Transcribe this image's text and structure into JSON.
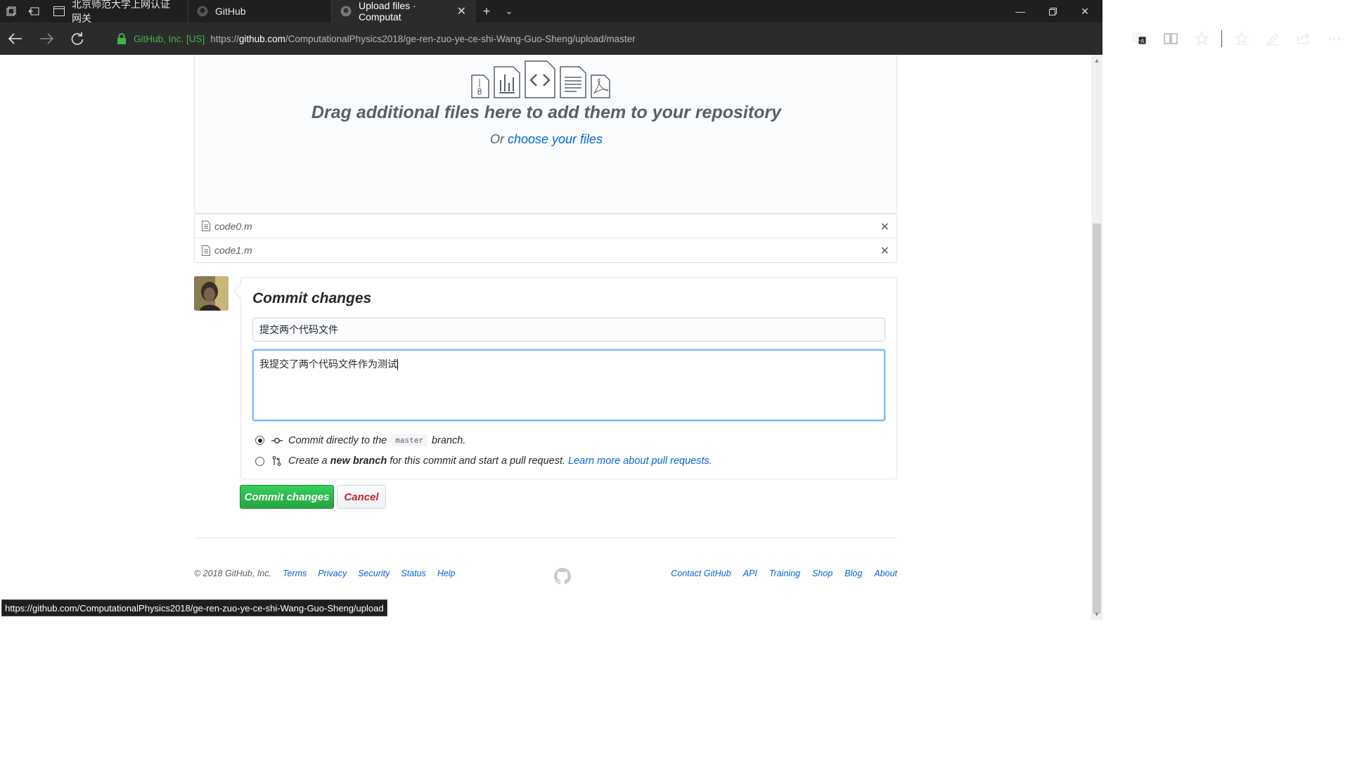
{
  "browser": {
    "tabs": [
      {
        "title": "北京师范大学上网认证网关",
        "active": false
      },
      {
        "title": "GitHub",
        "active": false
      },
      {
        "title": "Upload files · Computat",
        "active": true
      }
    ],
    "identity": "GitHub, Inc. [US]",
    "url_prefix": "https://",
    "url_host": "github.com",
    "url_rest": "/ComputationalPhysics2018/ge-ren-zuo-ye-ce-shi-Wang-Guo-Sheng/upload/master"
  },
  "dropzone": {
    "title": "Drag additional files here to add them to your repository",
    "or_text": "Or ",
    "choose_link": "choose your files"
  },
  "files": [
    {
      "name": "code0.m"
    },
    {
      "name": "code1.m"
    }
  ],
  "commit": {
    "title": "Commit changes",
    "summary_value": "提交两个代码文件",
    "description_value": "我提交了两个代码文件作为测试",
    "option1_prefix": "Commit directly to the",
    "option1_branch": "master",
    "option1_suffix": "branch.",
    "option2_prefix": "Create a",
    "option2_bold": "new branch",
    "option2_suffix": "for this commit and start a pull request.",
    "option2_link": "Learn more about pull requests.",
    "selected_option": 1,
    "commit_button": "Commit changes",
    "cancel_button": "Cancel"
  },
  "footer": {
    "copyright": "© 2018 GitHub, Inc.",
    "left_links": [
      "Terms",
      "Privacy",
      "Security",
      "Status",
      "Help"
    ],
    "right_links": [
      "Contact GitHub",
      "API",
      "Training",
      "Shop",
      "Blog",
      "About"
    ]
  },
  "status_url": "https://github.com/ComputationalPhysics2018/ge-ren-zuo-ye-ce-shi-Wang-Guo-Sheng/upload",
  "colors": {
    "accent_link": "#0366d6",
    "commit_green": "#28a745",
    "cancel_red": "#cb2431",
    "browser_chrome": "#2b2b2b"
  }
}
